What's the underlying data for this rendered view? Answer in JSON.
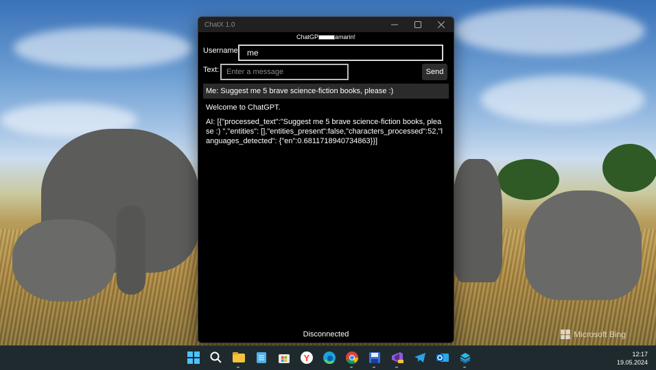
{
  "window": {
    "title": "ChatX 1.0",
    "banner_left": "ChatGP",
    "banner_right": "amarin!",
    "username_label": "Username:",
    "username_value": "me",
    "text_label": "Text:",
    "message_placeholder": "Enter a message",
    "send_label": "Send",
    "messages": {
      "me": "Me: Suggest me 5 brave science-fiction books, please :)",
      "welcome": "Welcome to ChatGPT.",
      "ai": "AI: [{\"processed_text\":\"Suggest me 5 brave science-fiction books, please :) \",\"entities\": [],\"entities_present\":false,\"characters_processed\":52,\"languages_detected\": {\"en\":0.6811718940734863}}]"
    },
    "status": "Disconnected"
  },
  "desktop": {
    "watermark": "Microsoft Bing"
  },
  "taskbar": {
    "apps": [
      "windows-start",
      "search",
      "file-explorer",
      "notepad",
      "microsoft-store",
      "yandex-browser",
      "edge",
      "chrome",
      "save-app",
      "visual-studio-preview",
      "telegram",
      "outlook",
      "layers-app"
    ],
    "time": "12:17",
    "date": "19.05.2024"
  },
  "colors": {
    "window_bg": "#000000",
    "titlebar_bg": "#202020",
    "taskbar_bg": "#1f2a2f"
  }
}
